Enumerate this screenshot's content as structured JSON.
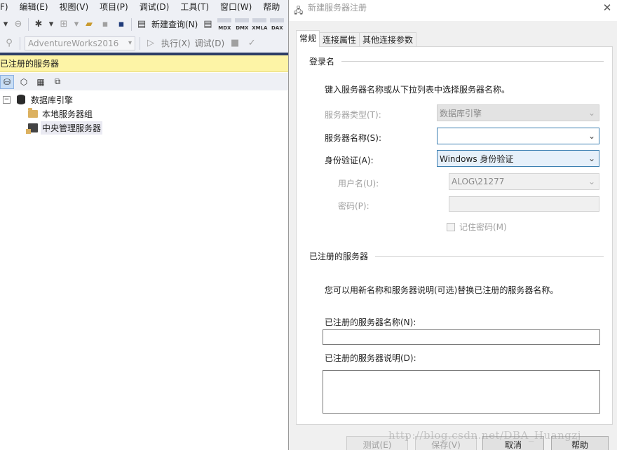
{
  "ide": {
    "menu": [
      "F)",
      "编辑(E)",
      "视图(V)",
      "项目(P)",
      "调试(D)",
      "工具(T)",
      "窗口(W)",
      "帮助"
    ],
    "toolbar": {
      "new_query_label": "新建查询(N)",
      "mdx": "MDX",
      "dmx": "DMX",
      "xmla": "XMLA",
      "dax": "DAX",
      "database_value": "AdventureWorks2016",
      "execute_label": "执行(X)",
      "debug_label": "调试(D)"
    },
    "panel": {
      "title": "已注册的服务器"
    },
    "tree": {
      "root_label": "数据库引擎",
      "root_expander": "⊟",
      "children": [
        {
          "label": "本地服务器组"
        },
        {
          "label": "中央管理服务器"
        }
      ]
    }
  },
  "dialog": {
    "title": "新建服务器注册",
    "close": "✕",
    "tabs": [
      "常规",
      "连接属性",
      "其他连接参数"
    ],
    "login": {
      "heading": "登录名",
      "instruction": "键入服务器名称或从下拉列表中选择服务器名称。",
      "server_type_label": "服务器类型(T):",
      "server_type_value": "数据库引擎",
      "server_name_label": "服务器名称(S):",
      "server_name_value": "",
      "auth_label": "身份验证(A):",
      "auth_value": "Windows 身份验证",
      "username_label": "用户名(U):",
      "username_value": "ALOG\\21277",
      "password_label": "密码(P):",
      "remember_label": "记住密码(M)"
    },
    "registered": {
      "heading": "已注册的服务器",
      "instruction": "您可以用新名称和服务器说明(可选)替换已注册的服务器名称。",
      "name_label": "已注册的服务器名称(N):",
      "name_value": "",
      "desc_label": "已注册的服务器说明(D):"
    },
    "buttons": {
      "test": "测试(E)",
      "save": "保存(V)",
      "cancel": "取消",
      "help": "帮助"
    }
  },
  "watermark": "http://blog.csdn.net/DBA_Huangzj"
}
